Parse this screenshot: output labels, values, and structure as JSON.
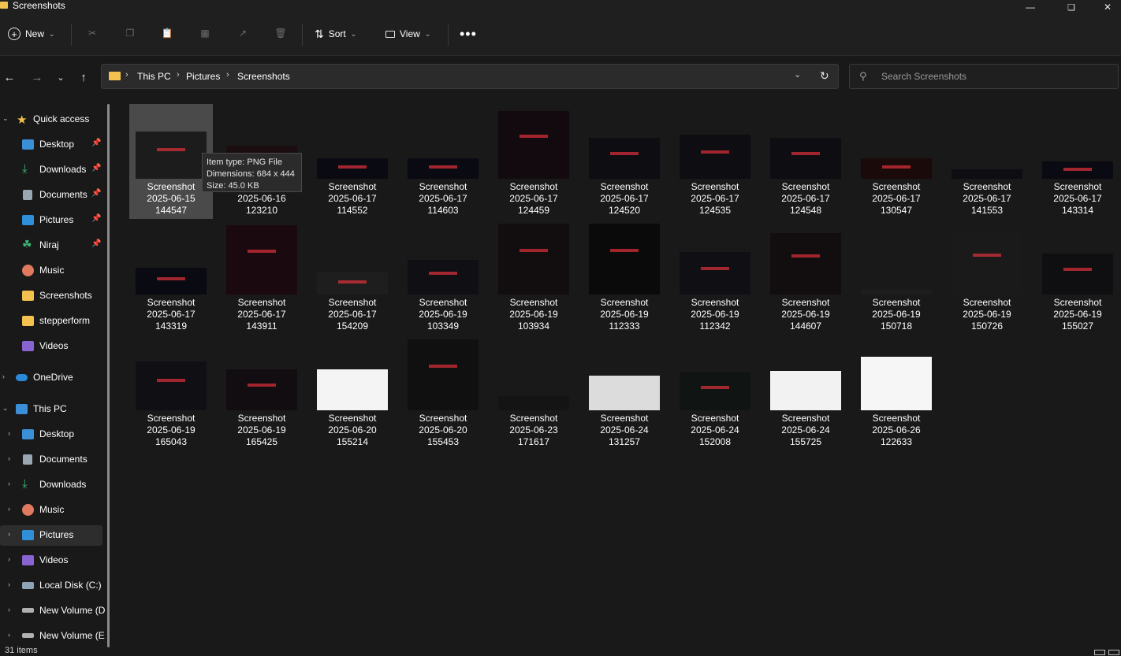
{
  "window": {
    "title": "Screenshots"
  },
  "colors": {
    "background": "#191919",
    "folder": "#f2c14e",
    "selection": "#4a4a4a",
    "accent_red": "#e0303a"
  },
  "toolbar": {
    "new_label": "New",
    "sort_label": "Sort",
    "view_label": "View",
    "icons": [
      "plus-circle-icon",
      "scissors-icon",
      "copy-icon",
      "paste-icon",
      "rename-icon",
      "share-icon",
      "delete-icon",
      "sort-icon",
      "view-icon",
      "more-icon"
    ]
  },
  "address": {
    "crumbs": [
      "This PC",
      "Pictures",
      "Screenshots"
    ]
  },
  "search": {
    "placeholder": "Search Screenshots"
  },
  "sidebar": {
    "items": [
      {
        "label": "Quick access",
        "icon": "star-icon",
        "pinned": false
      },
      {
        "label": "Desktop",
        "icon": "desktop-icon",
        "pinned": true
      },
      {
        "label": "Downloads",
        "icon": "download-icon",
        "pinned": true
      },
      {
        "label": "Documents",
        "icon": "document-icon",
        "pinned": true
      },
      {
        "label": "Pictures",
        "icon": "pictures-icon",
        "pinned": true
      },
      {
        "label": "Niraj",
        "icon": "tree-icon",
        "pinned": true
      },
      {
        "label": "Music",
        "icon": "music-icon",
        "pinned": false
      },
      {
        "label": "Screenshots",
        "icon": "folder-icon",
        "pinned": false
      },
      {
        "label": "stepperform",
        "icon": "folder-icon",
        "pinned": false
      },
      {
        "label": "Videos",
        "icon": "video-icon",
        "pinned": false
      },
      {
        "label": "OneDrive",
        "icon": "cloud-icon",
        "pinned": false
      },
      {
        "label": "This PC",
        "icon": "pc-icon",
        "pinned": false
      },
      {
        "label": "Desktop",
        "icon": "desktop-icon",
        "pinned": false
      },
      {
        "label": "Documents",
        "icon": "document-icon",
        "pinned": false
      },
      {
        "label": "Downloads",
        "icon": "download-icon",
        "pinned": false
      },
      {
        "label": "Music",
        "icon": "music-icon",
        "pinned": false
      },
      {
        "label": "Pictures",
        "icon": "pictures-icon",
        "pinned": false
      },
      {
        "label": "Videos",
        "icon": "video-icon",
        "pinned": false
      },
      {
        "label": "Local Disk (C:)",
        "icon": "disk-icon",
        "pinned": false
      },
      {
        "label": "New Volume (D",
        "icon": "drive-icon",
        "pinned": false
      },
      {
        "label": "New Volume (E",
        "icon": "drive-icon",
        "pinned": false
      }
    ]
  },
  "files": [
    {
      "name": "Screenshot",
      "date": "2025-06-15",
      "time": "144547"
    },
    {
      "name": "Screenshot",
      "date": "2025-06-16",
      "time": "123210"
    },
    {
      "name": "Screenshot",
      "date": "2025-06-17",
      "time": "114552"
    },
    {
      "name": "Screenshot",
      "date": "2025-06-17",
      "time": "114603"
    },
    {
      "name": "Screenshot",
      "date": "2025-06-17",
      "time": "124459"
    },
    {
      "name": "Screenshot",
      "date": "2025-06-17",
      "time": "124520"
    },
    {
      "name": "Screenshot",
      "date": "2025-06-17",
      "time": "124535"
    },
    {
      "name": "Screenshot",
      "date": "2025-06-17",
      "time": "124548"
    },
    {
      "name": "Screenshot",
      "date": "2025-06-17",
      "time": "130547"
    },
    {
      "name": "Screenshot",
      "date": "2025-06-17",
      "time": "141553"
    },
    {
      "name": "Screenshot",
      "date": "2025-06-17",
      "time": "143314"
    },
    {
      "name": "Screenshot",
      "date": "2025-06-17",
      "time": "143319"
    },
    {
      "name": "Screenshot",
      "date": "2025-06-17",
      "time": "143911"
    },
    {
      "name": "Screenshot",
      "date": "2025-06-17",
      "time": "154209"
    },
    {
      "name": "Screenshot",
      "date": "2025-06-19",
      "time": "103349"
    },
    {
      "name": "Screenshot",
      "date": "2025-06-19",
      "time": "103934"
    },
    {
      "name": "Screenshot",
      "date": "2025-06-19",
      "time": "112333"
    },
    {
      "name": "Screenshot",
      "date": "2025-06-19",
      "time": "112342"
    },
    {
      "name": "Screenshot",
      "date": "2025-06-19",
      "time": "144607"
    },
    {
      "name": "Screenshot",
      "date": "2025-06-19",
      "time": "150718"
    },
    {
      "name": "Screenshot",
      "date": "2025-06-19",
      "time": "150726"
    },
    {
      "name": "Screenshot",
      "date": "2025-06-19",
      "time": "155027"
    },
    {
      "name": "Screenshot",
      "date": "2025-06-19",
      "time": "165043"
    },
    {
      "name": "Screenshot",
      "date": "2025-06-19",
      "time": "165425"
    },
    {
      "name": "Screenshot",
      "date": "2025-06-20",
      "time": "155214"
    },
    {
      "name": "Screenshot",
      "date": "2025-06-20",
      "time": "155453"
    },
    {
      "name": "Screenshot",
      "date": "2025-06-23",
      "time": "171617"
    },
    {
      "name": "Screenshot",
      "date": "2025-06-24",
      "time": "131257"
    },
    {
      "name": "Screenshot",
      "date": "2025-06-24",
      "time": "152008"
    },
    {
      "name": "Screenshot",
      "date": "2025-06-24",
      "time": "155725"
    },
    {
      "name": "Screenshot",
      "date": "2025-06-26",
      "time": "122633"
    }
  ],
  "tooltip": {
    "type_line": "Item type: PNG File",
    "dimensions_line": "Dimensions: 684 x 444",
    "size_line": "Size: 45.0 KB"
  },
  "status": {
    "count_text": "31 items"
  }
}
